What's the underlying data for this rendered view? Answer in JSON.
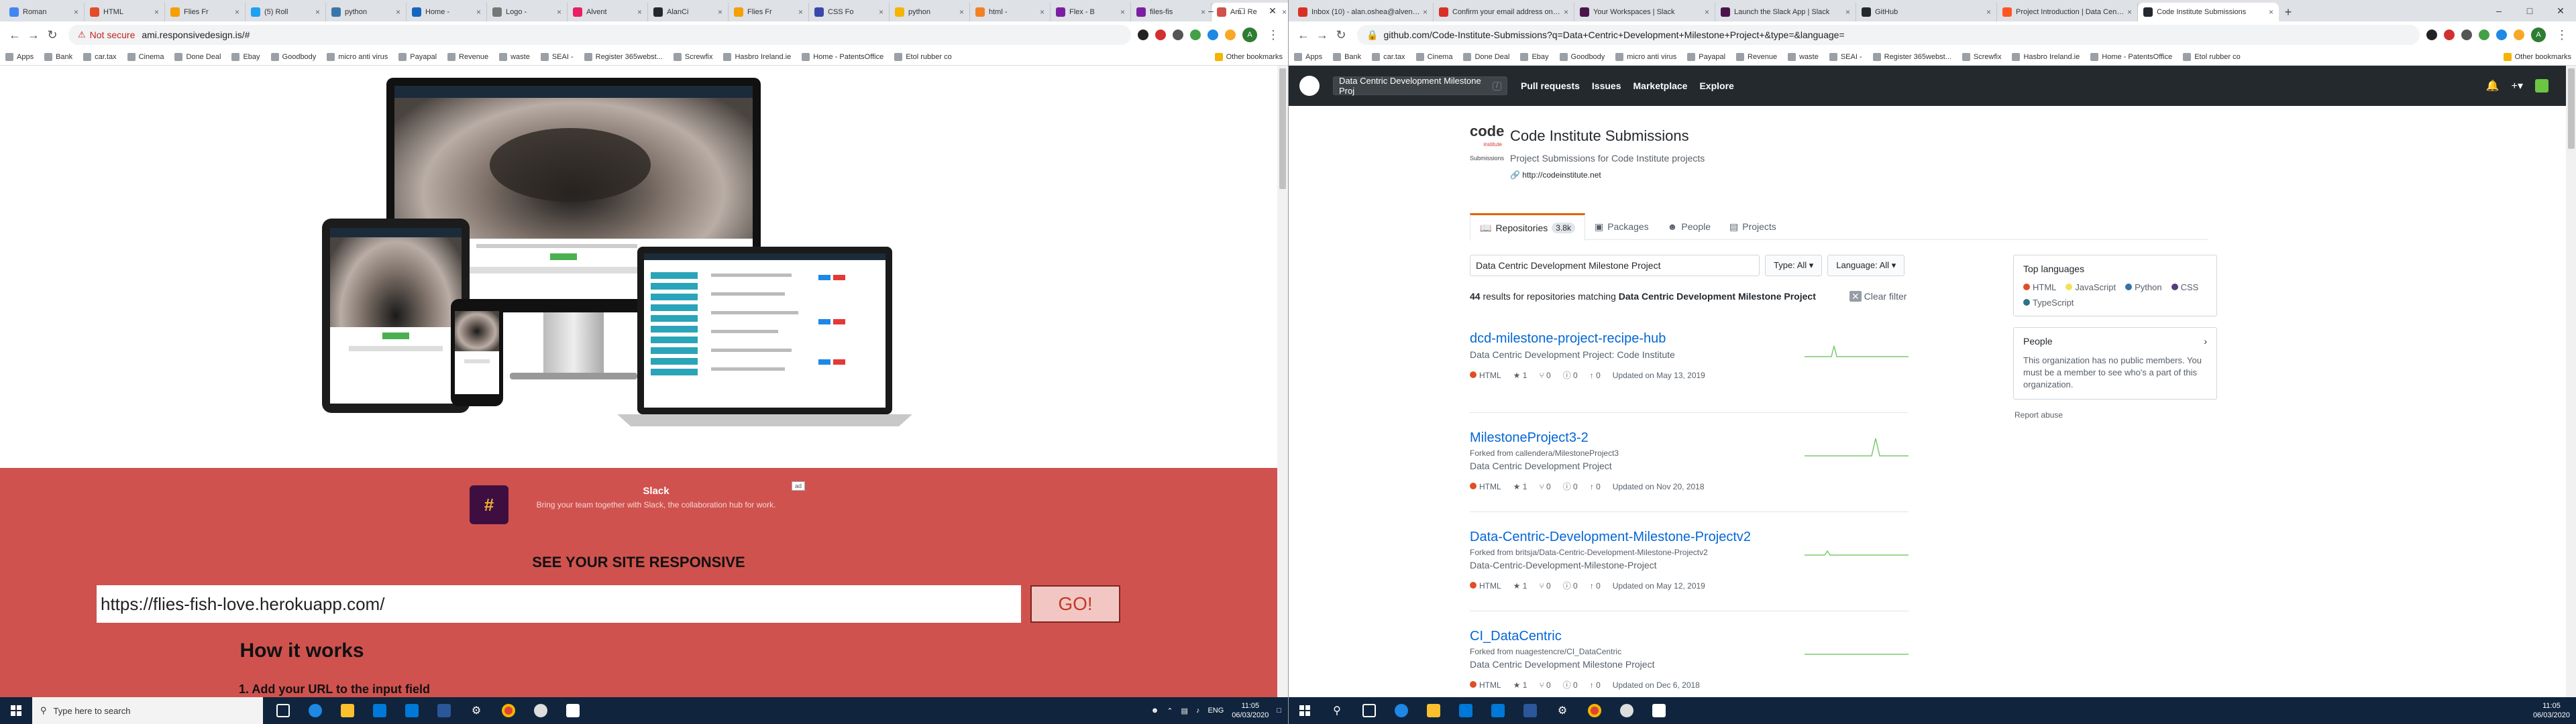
{
  "left": {
    "tabs": [
      {
        "title": "Roman",
        "color": "#4285f4"
      },
      {
        "title": "HTML",
        "color": "#e34c26"
      },
      {
        "title": "Flies Fr",
        "color": "#f4a000"
      },
      {
        "title": "(5) Roll",
        "color": "#1da1f2"
      },
      {
        "title": "python",
        "color": "#3776ab"
      },
      {
        "title": "Home -",
        "color": "#1565c0"
      },
      {
        "title": "Logo -",
        "color": "#777777"
      },
      {
        "title": "Alvent",
        "color": "#e91e63"
      },
      {
        "title": "AlanCi",
        "color": "#24292e"
      },
      {
        "title": "Flies Fr",
        "color": "#f4a000"
      },
      {
        "title": "CSS Fo",
        "color": "#3949ab"
      },
      {
        "title": "python",
        "color": "#f4b400"
      },
      {
        "title": "html -",
        "color": "#f48024"
      },
      {
        "title": "Flex - B",
        "color": "#7b1fa2"
      },
      {
        "title": "files-fis",
        "color": "#7b1fa2"
      },
      {
        "title": "Am I Re",
        "color": "#d0524e",
        "active": true
      }
    ],
    "address": {
      "warning": "Not secure",
      "url": "ami.responsivedesign.is/#"
    },
    "bookmarks": [
      "Apps",
      "Bank",
      "car.tax",
      "Cinema",
      "Done Deal",
      "Ebay",
      "Goodbody",
      "micro anti virus",
      "Payapal",
      "Revenue",
      "waste",
      "SEAI -",
      "Register 365webst...",
      "Screwfix",
      "Hasbro Ireland.ie",
      "Home - PatentsOffice",
      "Etol rubber co"
    ],
    "bookmarks_other": "Other bookmarks",
    "ad": {
      "title": "Slack",
      "text": "Bring your team together with Slack, the collaboration hub for work.",
      "badge": "ad"
    },
    "heading": "SEE YOUR SITE RESPONSIVE",
    "url_value": "https://flies-fish-love.herokuapp.com/",
    "go_label": "GO!",
    "how_title": "How it works",
    "step1": "1. Add your URL to the input field",
    "taskbar": {
      "search": "Type here to search",
      "lang": "ENG",
      "time": "11:05",
      "date": "06/03/2020"
    }
  },
  "right": {
    "tabs": [
      {
        "title": "Inbox (10) - alan.oshea@alventi...",
        "color": "#d93025"
      },
      {
        "title": "Confirm your email address on ...",
        "color": "#d93025"
      },
      {
        "title": "Your Workspaces | Slack",
        "color": "#4a154b"
      },
      {
        "title": "Launch the Slack App | Slack",
        "color": "#4a154b"
      },
      {
        "title": "GitHub",
        "color": "#24292e"
      },
      {
        "title": "Project Introduction | Data Centr...",
        "color": "#ff5722"
      },
      {
        "title": "Code Institute Submissions",
        "color": "#24292e",
        "active": true
      }
    ],
    "address": {
      "url": "github.com/Code-Institute-Submissions?q=Data+Centric+Development+Milestone+Project+&type=&language="
    },
    "bookmarks": [
      "Apps",
      "Bank",
      "car.tax",
      "Cinema",
      "Done Deal",
      "Ebay",
      "Goodbody",
      "micro anti virus",
      "Payapal",
      "Revenue",
      "waste",
      "SEAI -",
      "Register 365webst...",
      "Screwfix",
      "Hasbro Ireland.ie",
      "Home - PatentsOffice",
      "Etol rubber co"
    ],
    "bookmarks_other": "Other bookmarks",
    "gh": {
      "search": "Data Centric Development Milestone Proj",
      "nav": [
        "Pull requests",
        "Issues",
        "Marketplace",
        "Explore"
      ],
      "org_name": "Code Institute Submissions",
      "org_desc": "Project Submissions for Code Institute projects",
      "org_url": "http://codeinstitute.net",
      "logo_text": "code",
      "logo_sub": "institute",
      "logo_caption": "Submissions",
      "tabs": [
        {
          "label": "Repositories",
          "count": "3.8k",
          "selected": true
        },
        {
          "label": "Packages"
        },
        {
          "label": "People"
        },
        {
          "label": "Projects"
        }
      ],
      "filter_value": "Data Centric Development Milestone Project",
      "type_btn": "Type: All",
      "lang_btn": "Language: All",
      "results_count": "44",
      "results_text": "results for repositories matching",
      "results_query": "Data Centric Development Milestone Project",
      "clear_filter": "Clear filter",
      "repos": [
        {
          "name": "dcd-milestone-project-recipe-hub",
          "fork": "",
          "desc": "Data Centric Development Project: Code Institute",
          "lang": "HTML",
          "stars": "1",
          "forks": "0",
          "issues": "0",
          "prs": "0",
          "updated": "Updated on May 13, 2019"
        },
        {
          "name": "MilestoneProject3-2",
          "fork": "Forked from callendera/MilestoneProject3",
          "desc": "Data Centric Development Project",
          "lang": "HTML",
          "stars": "1",
          "forks": "0",
          "issues": "0",
          "prs": "0",
          "updated": "Updated on Nov 20, 2018"
        },
        {
          "name": "Data-Centric-Development-Milestone-Projectv2",
          "fork": "Forked from britsja/Data-Centric-Development-Milestone-Projectv2",
          "desc": "Data-Centric-Development-Milestone-Project",
          "lang": "HTML",
          "stars": "1",
          "forks": "0",
          "issues": "0",
          "prs": "0",
          "updated": "Updated on May 12, 2019"
        },
        {
          "name": "CI_DataCentric",
          "fork": "Forked from nuagestencre/CI_DataCentric",
          "desc": "Data Centric Development Milestone Project",
          "lang": "HTML",
          "stars": "1",
          "forks": "0",
          "issues": "0",
          "prs": "0",
          "updated": "Updated on Dec 6, 2018"
        }
      ],
      "top_languages_title": "Top languages",
      "languages": [
        {
          "name": "HTML",
          "color": "#e34c26"
        },
        {
          "name": "JavaScript",
          "color": "#f1e05a"
        },
        {
          "name": "Python",
          "color": "#3572a5"
        },
        {
          "name": "CSS",
          "color": "#563d7c"
        },
        {
          "name": "TypeScript",
          "color": "#2b7489"
        }
      ],
      "people_title": "People",
      "people_text": "This organization has no public members. You must be a member to see who's a part of this organization.",
      "report": "Report abuse"
    },
    "taskbar": {
      "time": "11:05",
      "date": "06/03/2020"
    }
  }
}
